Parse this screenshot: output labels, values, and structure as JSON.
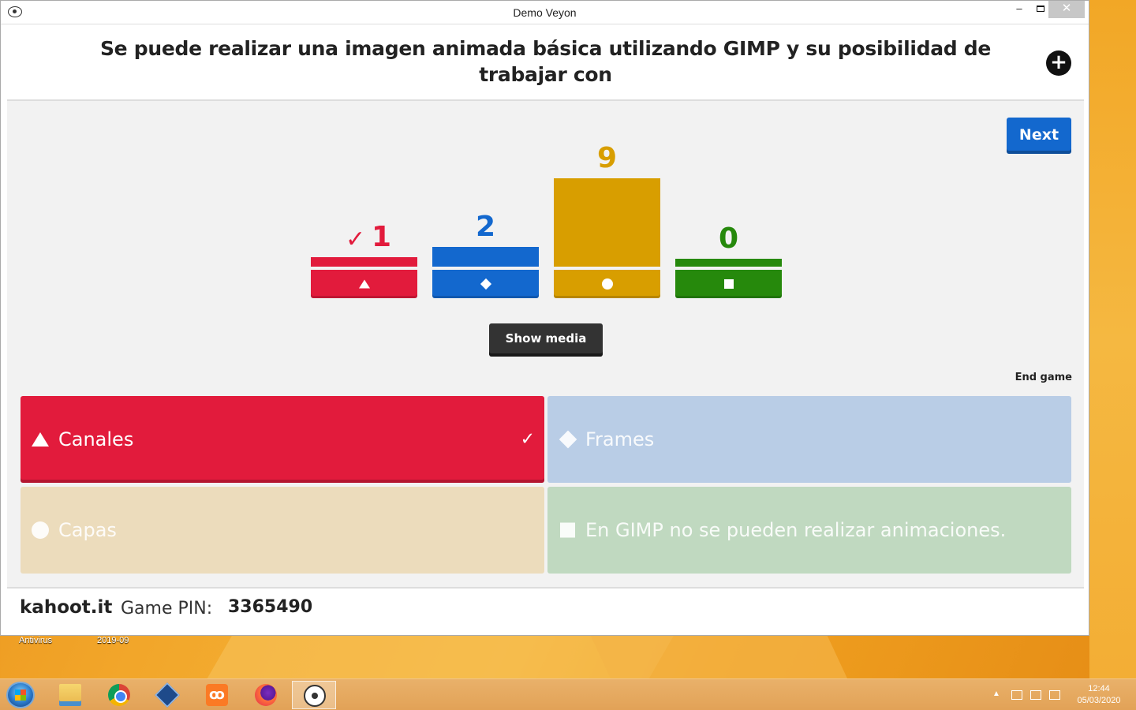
{
  "window": {
    "title": "Demo Veyon",
    "minimize": "‒",
    "close": "✕"
  },
  "question": {
    "text": "Se puede realizar una imagen animada básica utilizando GIMP y su posibilidad de trabajar con"
  },
  "controls": {
    "next": "Next",
    "show_media": "Show media",
    "end_game": "End game",
    "plus_icon": "+"
  },
  "chart_data": {
    "type": "bar",
    "categories": [
      "Canales",
      "Frames",
      "Capas",
      "En GIMP no se pueden realizar animaciones."
    ],
    "values": [
      1,
      2,
      9,
      0
    ],
    "labels": [
      "1",
      "2",
      "9",
      "0"
    ],
    "colors": [
      "#e21b3c",
      "#1368ce",
      "#d89e00",
      "#26890c"
    ],
    "shapes": [
      "triangle",
      "diamond",
      "circle",
      "square"
    ],
    "correct_index": 0,
    "check_mark": "✓"
  },
  "answers": [
    {
      "label": "Canales",
      "shape": "triangle",
      "color": "#e21b3c",
      "correct": true,
      "check": "✓"
    },
    {
      "label": "Frames",
      "shape": "diamond",
      "color": "#b9cde6",
      "correct": false
    },
    {
      "label": "Capas",
      "shape": "circle",
      "color": "#ecdcbc",
      "correct": false
    },
    {
      "label": "En GIMP no se pueden realizar animaciones.",
      "shape": "square",
      "color": "#c0d9c0",
      "correct": false
    }
  ],
  "footer": {
    "brand": "kahoot.it",
    "pin_label": "Game PIN:",
    "pin": "3365490"
  },
  "desktop": {
    "labels": [
      "Antivirus",
      "2019-09"
    ]
  },
  "taskbar": {
    "apps": [
      "start-icon",
      "file-explorer-icon",
      "chrome-icon",
      "virtualbox-icon",
      "xampp-icon",
      "firefox-icon",
      "veyon-icon"
    ],
    "tray_arrow": "▲",
    "time": "12:44",
    "date": "05/03/2020"
  }
}
